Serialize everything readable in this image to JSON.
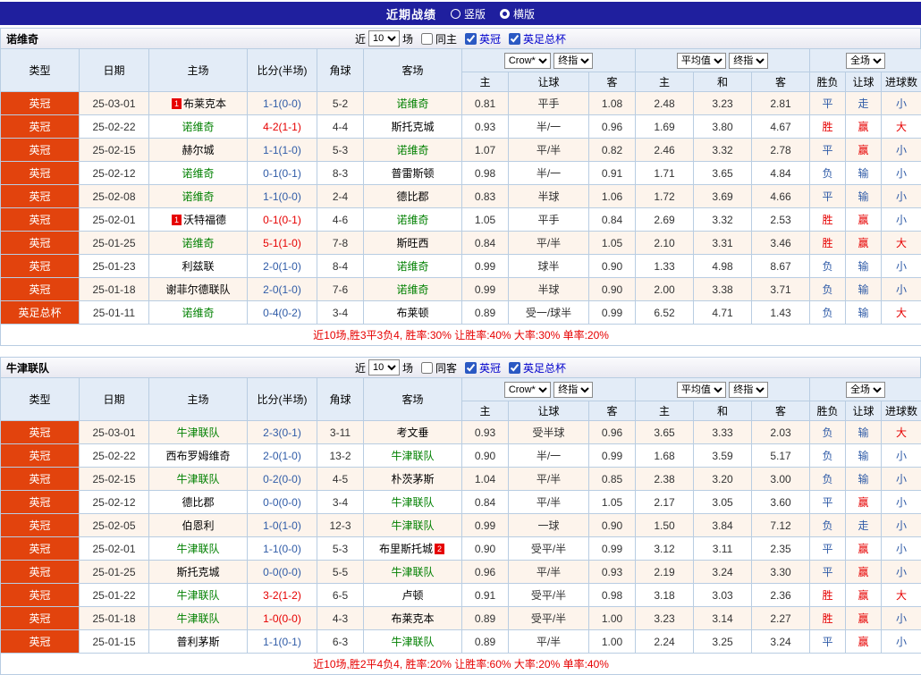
{
  "title_bar": {
    "title": "近期战绩",
    "radio_options": [
      {
        "label": "竖版",
        "selected": false
      },
      {
        "label": "横版",
        "selected": true
      }
    ]
  },
  "colors": {
    "title_bar_bg": "#1f1f9e",
    "type_cell_bg": "#e2430d",
    "header_bg": "#e3ecf7",
    "win_red": "#e60000",
    "result_blue": "#2f5ba7",
    "focus_team_green": "#008000"
  },
  "columns": {
    "type": "类型",
    "date": "日期",
    "home": "主场",
    "score": "比分(半场)",
    "corner": "角球",
    "away": "客场",
    "odds_sub": [
      "主",
      "让球",
      "客"
    ],
    "europe_sub": [
      "主",
      "和",
      "客"
    ],
    "result_sub": [
      "胜负",
      "让球",
      "进球数"
    ]
  },
  "dropdowns": {
    "crow": "Crow*",
    "final1": "终指",
    "average": "平均值",
    "final2": "终指",
    "fullmatch": "全场"
  },
  "filters_common": {
    "near": "近",
    "games": "10",
    "games_unit": "场",
    "league1": "英冠",
    "league2": "英足总杯"
  },
  "sections": [
    {
      "team": "诺维奇",
      "same_side_label": "同主",
      "same_side_checked": false,
      "league1_checked": true,
      "league2_checked": true,
      "summary": "近10场,胜3平3负4, 胜率:30% 让胜率:40% 大率:30% 单率:20%",
      "rows": [
        {
          "type": "英冠",
          "date": "25-03-01",
          "home": "布莱克本",
          "home_badge": "1",
          "home_focus": false,
          "score": "1-1(0-0)",
          "corner": "5-2",
          "away": "诺维奇",
          "away_focus": true,
          "h1": "0.81",
          "handicap": "平手",
          "h2": "1.08",
          "e1": "2.48",
          "e2": "3.23",
          "e3": "2.81",
          "r1": "平",
          "r2": "走",
          "r3": "小"
        },
        {
          "type": "英冠",
          "date": "25-02-22",
          "home": "诺维奇",
          "home_focus": true,
          "score": "4-2(1-1)",
          "corner": "4-4",
          "away": "斯托克城",
          "away_focus": false,
          "h1": "0.93",
          "handicap": "半/一",
          "h2": "0.96",
          "e1": "1.69",
          "e2": "3.80",
          "e3": "4.67",
          "r1": "胜",
          "r2": "赢",
          "r3": "大"
        },
        {
          "type": "英冠",
          "date": "25-02-15",
          "home": "赫尔城",
          "home_focus": false,
          "score": "1-1(1-0)",
          "corner": "5-3",
          "away": "诺维奇",
          "away_focus": true,
          "h1": "1.07",
          "handicap": "平/半",
          "h2": "0.82",
          "e1": "2.46",
          "e2": "3.32",
          "e3": "2.78",
          "r1": "平",
          "r2": "赢",
          "r3": "小"
        },
        {
          "type": "英冠",
          "date": "25-02-12",
          "home": "诺维奇",
          "home_focus": true,
          "score": "0-1(0-1)",
          "corner": "8-3",
          "away": "普雷斯顿",
          "away_focus": false,
          "h1": "0.98",
          "handicap": "半/一",
          "h2": "0.91",
          "e1": "1.71",
          "e2": "3.65",
          "e3": "4.84",
          "r1": "负",
          "r2": "输",
          "r3": "小"
        },
        {
          "type": "英冠",
          "date": "25-02-08",
          "home": "诺维奇",
          "home_focus": true,
          "score": "1-1(0-0)",
          "corner": "2-4",
          "away": "德比郡",
          "away_focus": false,
          "h1": "0.83",
          "handicap": "半球",
          "h2": "1.06",
          "e1": "1.72",
          "e2": "3.69",
          "e3": "4.66",
          "r1": "平",
          "r2": "输",
          "r3": "小"
        },
        {
          "type": "英冠",
          "date": "25-02-01",
          "home": "沃特福德",
          "home_badge": "1",
          "home_focus": false,
          "score": "0-1(0-1)",
          "corner": "4-6",
          "away": "诺维奇",
          "away_focus": true,
          "h1": "1.05",
          "handicap": "平手",
          "h2": "0.84",
          "e1": "2.69",
          "e2": "3.32",
          "e3": "2.53",
          "r1": "胜",
          "r2": "赢",
          "r3": "小"
        },
        {
          "type": "英冠",
          "date": "25-01-25",
          "home": "诺维奇",
          "home_focus": true,
          "score": "5-1(1-0)",
          "corner": "7-8",
          "away": "斯旺西",
          "away_focus": false,
          "h1": "0.84",
          "handicap": "平/半",
          "h2": "1.05",
          "e1": "2.10",
          "e2": "3.31",
          "e3": "3.46",
          "r1": "胜",
          "r2": "赢",
          "r3": "大"
        },
        {
          "type": "英冠",
          "date": "25-01-23",
          "home": "利兹联",
          "home_focus": false,
          "score": "2-0(1-0)",
          "corner": "8-4",
          "away": "诺维奇",
          "away_focus": true,
          "h1": "0.99",
          "handicap": "球半",
          "h2": "0.90",
          "e1": "1.33",
          "e2": "4.98",
          "e3": "8.67",
          "r1": "负",
          "r2": "输",
          "r3": "小"
        },
        {
          "type": "英冠",
          "date": "25-01-18",
          "home": "谢菲尔德联队",
          "home_focus": false,
          "score": "2-0(1-0)",
          "corner": "7-6",
          "away": "诺维奇",
          "away_focus": true,
          "h1": "0.99",
          "handicap": "半球",
          "h2": "0.90",
          "e1": "2.00",
          "e2": "3.38",
          "e3": "3.71",
          "r1": "负",
          "r2": "输",
          "r3": "小"
        },
        {
          "type": "英足总杯",
          "date": "25-01-11",
          "home": "诺维奇",
          "home_focus": true,
          "score": "0-4(0-2)",
          "corner": "3-4",
          "away": "布莱顿",
          "away_focus": false,
          "h1": "0.89",
          "handicap": "受一/球半",
          "h2": "0.99",
          "e1": "6.52",
          "e2": "4.71",
          "e3": "1.43",
          "r1": "负",
          "r2": "输",
          "r3": "大"
        }
      ]
    },
    {
      "team": "牛津联队",
      "same_side_label": "同客",
      "same_side_checked": false,
      "league1_checked": true,
      "league2_checked": true,
      "summary": "近10场,胜2平4负4, 胜率:20% 让胜率:60% 大率:20% 单率:40%",
      "rows": [
        {
          "type": "英冠",
          "date": "25-03-01",
          "home": "牛津联队",
          "home_focus": true,
          "score": "2-3(0-1)",
          "corner": "3-11",
          "away": "考文垂",
          "away_focus": false,
          "h1": "0.93",
          "handicap": "受半球",
          "h2": "0.96",
          "e1": "3.65",
          "e2": "3.33",
          "e3": "2.03",
          "r1": "负",
          "r2": "输",
          "r3": "大"
        },
        {
          "type": "英冠",
          "date": "25-02-22",
          "home": "西布罗姆维奇",
          "home_focus": false,
          "score": "2-0(1-0)",
          "corner": "13-2",
          "away": "牛津联队",
          "away_focus": true,
          "h1": "0.90",
          "handicap": "半/一",
          "h2": "0.99",
          "e1": "1.68",
          "e2": "3.59",
          "e3": "5.17",
          "r1": "负",
          "r2": "输",
          "r3": "小"
        },
        {
          "type": "英冠",
          "date": "25-02-15",
          "home": "牛津联队",
          "home_focus": true,
          "score": "0-2(0-0)",
          "corner": "4-5",
          "away": "朴茨茅斯",
          "away_focus": false,
          "h1": "1.04",
          "handicap": "平/半",
          "h2": "0.85",
          "e1": "2.38",
          "e2": "3.20",
          "e3": "3.00",
          "r1": "负",
          "r2": "输",
          "r3": "小"
        },
        {
          "type": "英冠",
          "date": "25-02-12",
          "home": "德比郡",
          "home_focus": false,
          "score": "0-0(0-0)",
          "corner": "3-4",
          "away": "牛津联队",
          "away_focus": true,
          "h1": "0.84",
          "handicap": "平/半",
          "h2": "1.05",
          "e1": "2.17",
          "e2": "3.05",
          "e3": "3.60",
          "r1": "平",
          "r2": "赢",
          "r3": "小"
        },
        {
          "type": "英冠",
          "date": "25-02-05",
          "home": "伯恩利",
          "home_focus": false,
          "score": "1-0(1-0)",
          "corner": "12-3",
          "away": "牛津联队",
          "away_focus": true,
          "h1": "0.99",
          "handicap": "一球",
          "h2": "0.90",
          "e1": "1.50",
          "e2": "3.84",
          "e3": "7.12",
          "r1": "负",
          "r2": "走",
          "r3": "小"
        },
        {
          "type": "英冠",
          "date": "25-02-01",
          "home": "牛津联队",
          "home_focus": true,
          "score": "1-1(0-0)",
          "corner": "5-3",
          "away": "布里斯托城",
          "away_badge": "2",
          "away_focus": false,
          "h1": "0.90",
          "handicap": "受平/半",
          "h2": "0.99",
          "e1": "3.12",
          "e2": "3.11",
          "e3": "2.35",
          "r1": "平",
          "r2": "赢",
          "r3": "小"
        },
        {
          "type": "英冠",
          "date": "25-01-25",
          "home": "斯托克城",
          "home_focus": false,
          "score": "0-0(0-0)",
          "corner": "5-5",
          "away": "牛津联队",
          "away_focus": true,
          "h1": "0.96",
          "handicap": "平/半",
          "h2": "0.93",
          "e1": "2.19",
          "e2": "3.24",
          "e3": "3.30",
          "r1": "平",
          "r2": "赢",
          "r3": "小"
        },
        {
          "type": "英冠",
          "date": "25-01-22",
          "home": "牛津联队",
          "home_focus": true,
          "score": "3-2(1-2)",
          "corner": "6-5",
          "away": "卢顿",
          "away_focus": false,
          "h1": "0.91",
          "handicap": "受平/半",
          "h2": "0.98",
          "e1": "3.18",
          "e2": "3.03",
          "e3": "2.36",
          "r1": "胜",
          "r2": "赢",
          "r3": "大"
        },
        {
          "type": "英冠",
          "date": "25-01-18",
          "home": "牛津联队",
          "home_focus": true,
          "score": "1-0(0-0)",
          "corner": "4-3",
          "away": "布莱克本",
          "away_focus": false,
          "h1": "0.89",
          "handicap": "受平/半",
          "h2": "1.00",
          "e1": "3.23",
          "e2": "3.14",
          "e3": "2.27",
          "r1": "胜",
          "r2": "赢",
          "r3": "小"
        },
        {
          "type": "英冠",
          "date": "25-01-15",
          "home": "普利茅斯",
          "home_focus": false,
          "score": "1-1(0-1)",
          "corner": "6-3",
          "away": "牛津联队",
          "away_focus": true,
          "h1": "0.89",
          "handicap": "平/半",
          "h2": "1.00",
          "e1": "2.24",
          "e2": "3.25",
          "e3": "3.24",
          "r1": "平",
          "r2": "赢",
          "r3": "小"
        }
      ]
    }
  ]
}
